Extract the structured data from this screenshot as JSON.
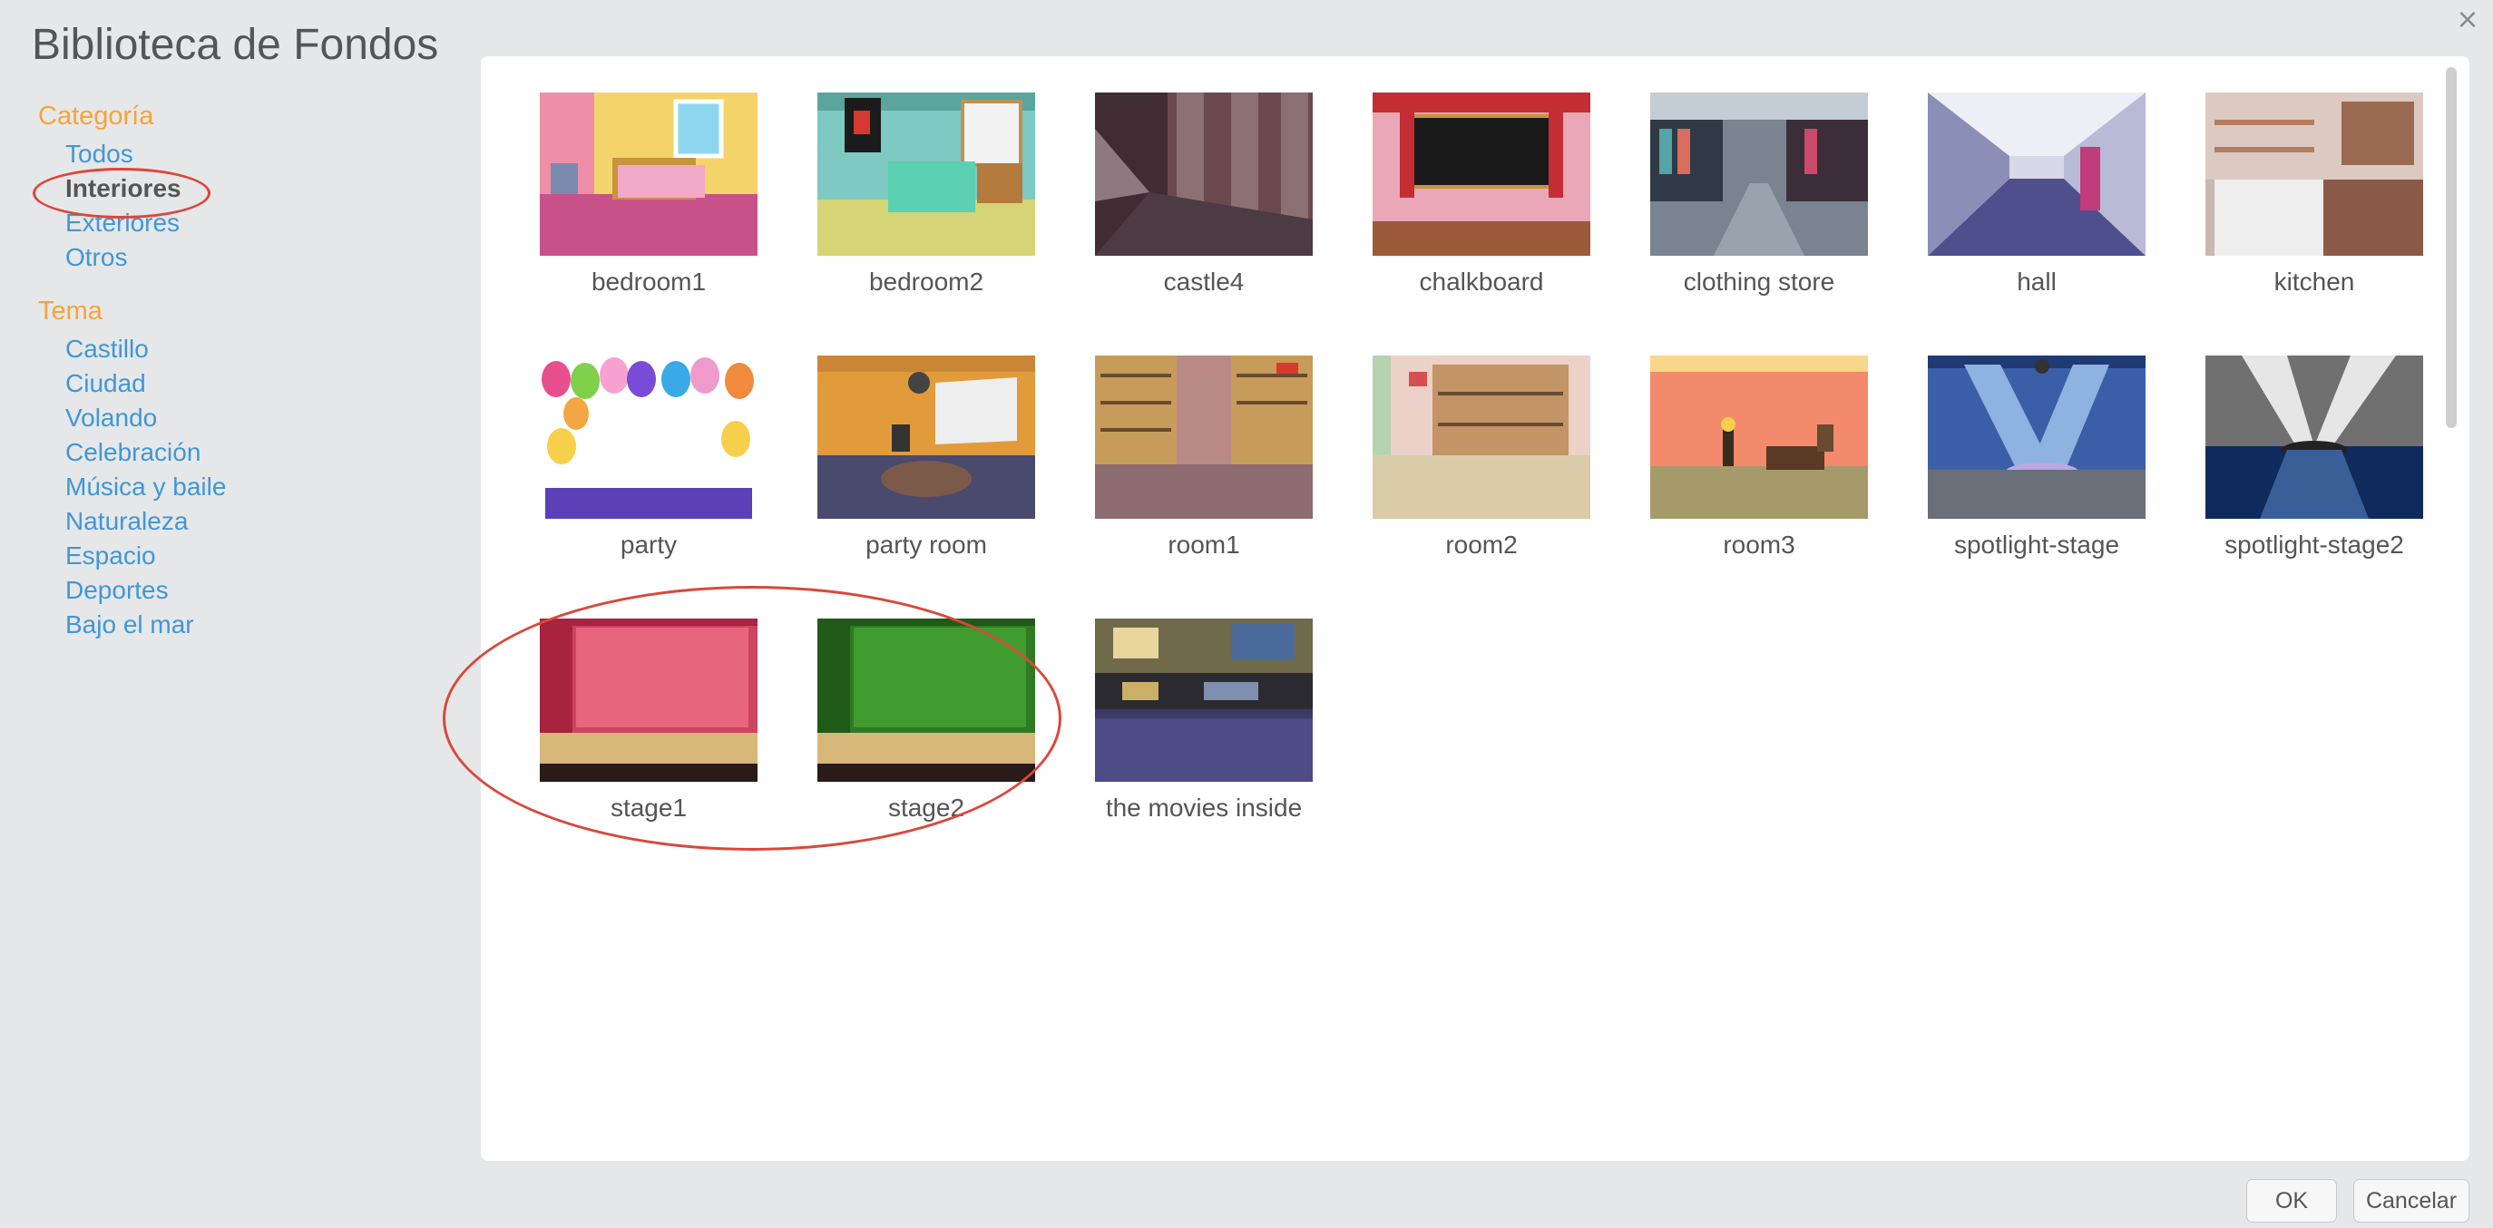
{
  "dialog": {
    "title": "Biblioteca de Fondos",
    "close_glyph": "×"
  },
  "sidebar": {
    "category_header": "Categoría",
    "categories": [
      {
        "label": "Todos",
        "selected": false
      },
      {
        "label": "Interiores",
        "selected": true
      },
      {
        "label": "Exteriores",
        "selected": false
      },
      {
        "label": "Otros",
        "selected": false
      }
    ],
    "theme_header": "Tema",
    "themes": [
      "Castillo",
      "Ciudad",
      "Volando",
      "Celebración",
      "Música y baile",
      "Naturaleza",
      "Espacio",
      "Deportes",
      "Bajo el mar"
    ]
  },
  "backdrops": [
    {
      "name": "bedroom1",
      "icon": "bedroom-pink-thumbnail"
    },
    {
      "name": "bedroom2",
      "icon": "bedroom-teal-thumbnail"
    },
    {
      "name": "castle4",
      "icon": "castle-stairs-thumbnail"
    },
    {
      "name": "chalkboard",
      "icon": "chalkboard-thumbnail"
    },
    {
      "name": "clothing store",
      "icon": "clothing-store-thumbnail"
    },
    {
      "name": "hall",
      "icon": "hall-corridor-thumbnail"
    },
    {
      "name": "kitchen",
      "icon": "kitchen-thumbnail"
    },
    {
      "name": "party",
      "icon": "balloons-thumbnail"
    },
    {
      "name": "party room",
      "icon": "party-room-thumbnail"
    },
    {
      "name": "room1",
      "icon": "room-shelves-thumbnail"
    },
    {
      "name": "room2",
      "icon": "room-shelves-checker-thumbnail"
    },
    {
      "name": "room3",
      "icon": "room-orange-thumbnail"
    },
    {
      "name": "spotlight-stage",
      "icon": "spotlight-stage-thumbnail"
    },
    {
      "name": "spotlight-stage2",
      "icon": "spotlight-stage-dark-thumbnail"
    },
    {
      "name": "stage1",
      "icon": "stage-red-curtain-thumbnail"
    },
    {
      "name": "stage2",
      "icon": "stage-green-curtain-thumbnail"
    },
    {
      "name": "the movies inside",
      "icon": "movie-theater-lobby-thumbnail"
    }
  ],
  "buttons": {
    "ok": "OK",
    "cancel": "Cancelar"
  },
  "annotation_color": "#d9483b",
  "accent_colors": {
    "header": "#f6a33a",
    "link": "#3f97d8"
  }
}
